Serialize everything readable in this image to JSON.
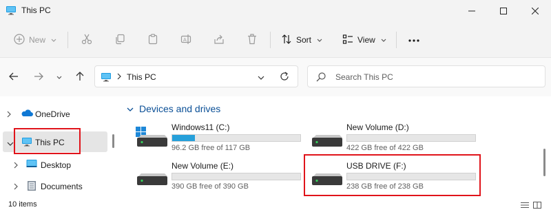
{
  "window": {
    "title": "This PC",
    "controls": [
      "minimize",
      "maximize",
      "close"
    ]
  },
  "toolbar": {
    "new_label": "New",
    "sort_label": "Sort",
    "view_label": "View",
    "icons": [
      "cut-icon",
      "copy-icon",
      "paste-icon",
      "rename-icon",
      "share-icon",
      "delete-icon",
      "more-icon"
    ]
  },
  "address": {
    "path": "This PC"
  },
  "search": {
    "placeholder": "Search This PC"
  },
  "sidebar": {
    "items": [
      {
        "label": "OneDrive",
        "icon": "cloud-icon"
      },
      {
        "label": "This PC",
        "icon": "computer-icon",
        "selected": true
      },
      {
        "label": "Desktop",
        "icon": "desktop-folder-icon"
      },
      {
        "label": "Documents",
        "icon": "documents-icon"
      }
    ]
  },
  "content": {
    "group_title": "Devices and drives",
    "drives": [
      {
        "name": "Windows11 (C:)",
        "free_text": "96.2 GB free of 117 GB",
        "used_fraction": 0.18,
        "icon": "windows-drive-icon"
      },
      {
        "name": "New Volume (D:)",
        "free_text": "422 GB free of 422 GB",
        "used_fraction": 0.0,
        "icon": "drive-icon"
      },
      {
        "name": "New Volume (E:)",
        "free_text": "390 GB free of 390 GB",
        "used_fraction": 0.0,
        "icon": "drive-icon"
      },
      {
        "name": "USB DRIVE (F:)",
        "free_text": "238 GB free of 238 GB",
        "used_fraction": 0.0,
        "icon": "drive-icon"
      }
    ]
  },
  "status": {
    "item_count": "10 items"
  },
  "colors": {
    "accent": "#26a0da",
    "highlight": "#e0131a",
    "group_title": "#0a4f96"
  }
}
